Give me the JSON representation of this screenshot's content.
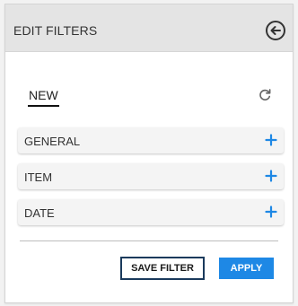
{
  "header": {
    "title": "EDIT FILTERS",
    "back_icon": "circle-arrow-left-icon"
  },
  "tabs": {
    "active_label": "NEW",
    "refresh_icon": "refresh-icon"
  },
  "sections": [
    {
      "label": "GENERAL",
      "icon": "plus-icon"
    },
    {
      "label": "ITEM",
      "icon": "plus-icon"
    },
    {
      "label": "DATE",
      "icon": "plus-icon"
    }
  ],
  "actions": {
    "save_label": "SAVE FILTER",
    "apply_label": "APPLY"
  },
  "colors": {
    "accent": "#1e88e5",
    "save_border": "#1a3a5c",
    "header_bg": "#e4e4e4"
  }
}
